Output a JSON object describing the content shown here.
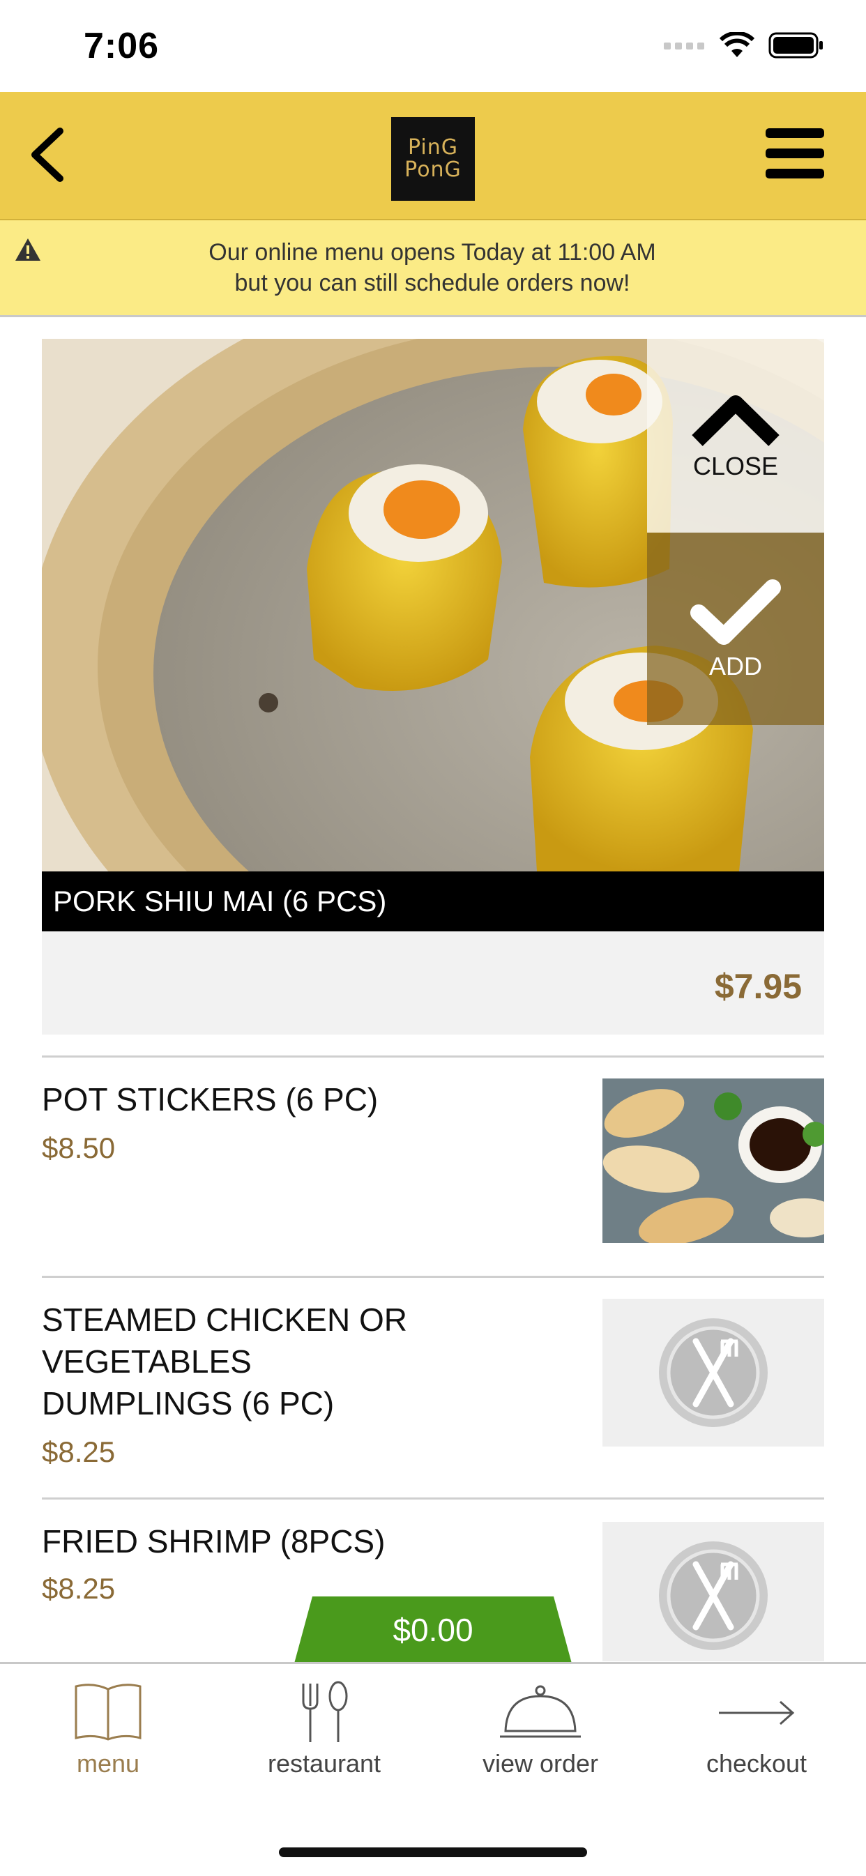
{
  "status_bar": {
    "time": "7:06"
  },
  "header": {
    "logo_line1": "PinG",
    "logo_line2": "PonG"
  },
  "banner": {
    "line1": "Our online menu opens Today at 11:00 AM",
    "line2": "but you can still schedule orders now!"
  },
  "featured": {
    "close_label": "CLOSE",
    "add_label": "ADD",
    "title": "PORK SHIU MAI (6 PCS)",
    "price": "$7.95"
  },
  "items": [
    {
      "name": "POT STICKERS (6 PC)",
      "price": "$8.50",
      "image": "pot-stickers-photo"
    },
    {
      "name": "STEAMED CHICKEN OR VEGETABLES DUMPLINGS (6 PC)",
      "price": "$8.25",
      "image": "placeholder-utensils"
    },
    {
      "name": "FRIED SHRIMP (8PCS)",
      "price": "$8.25",
      "image": "placeholder-utensils"
    }
  ],
  "cart": {
    "total": "$0.00",
    "color": "#4a9a1c"
  },
  "tabs": [
    {
      "label": "menu",
      "icon": "book-icon",
      "active": true
    },
    {
      "label": "restaurant",
      "icon": "fork-spoon-icon",
      "active": false
    },
    {
      "label": "view order",
      "icon": "cloche-icon",
      "active": false
    },
    {
      "label": "checkout",
      "icon": "arrow-right-icon",
      "active": false
    }
  ],
  "colors": {
    "header": "#edcb4c",
    "banner": "#fbeb86",
    "price": "#8a6a36",
    "accent_green": "#4a9a1c"
  }
}
